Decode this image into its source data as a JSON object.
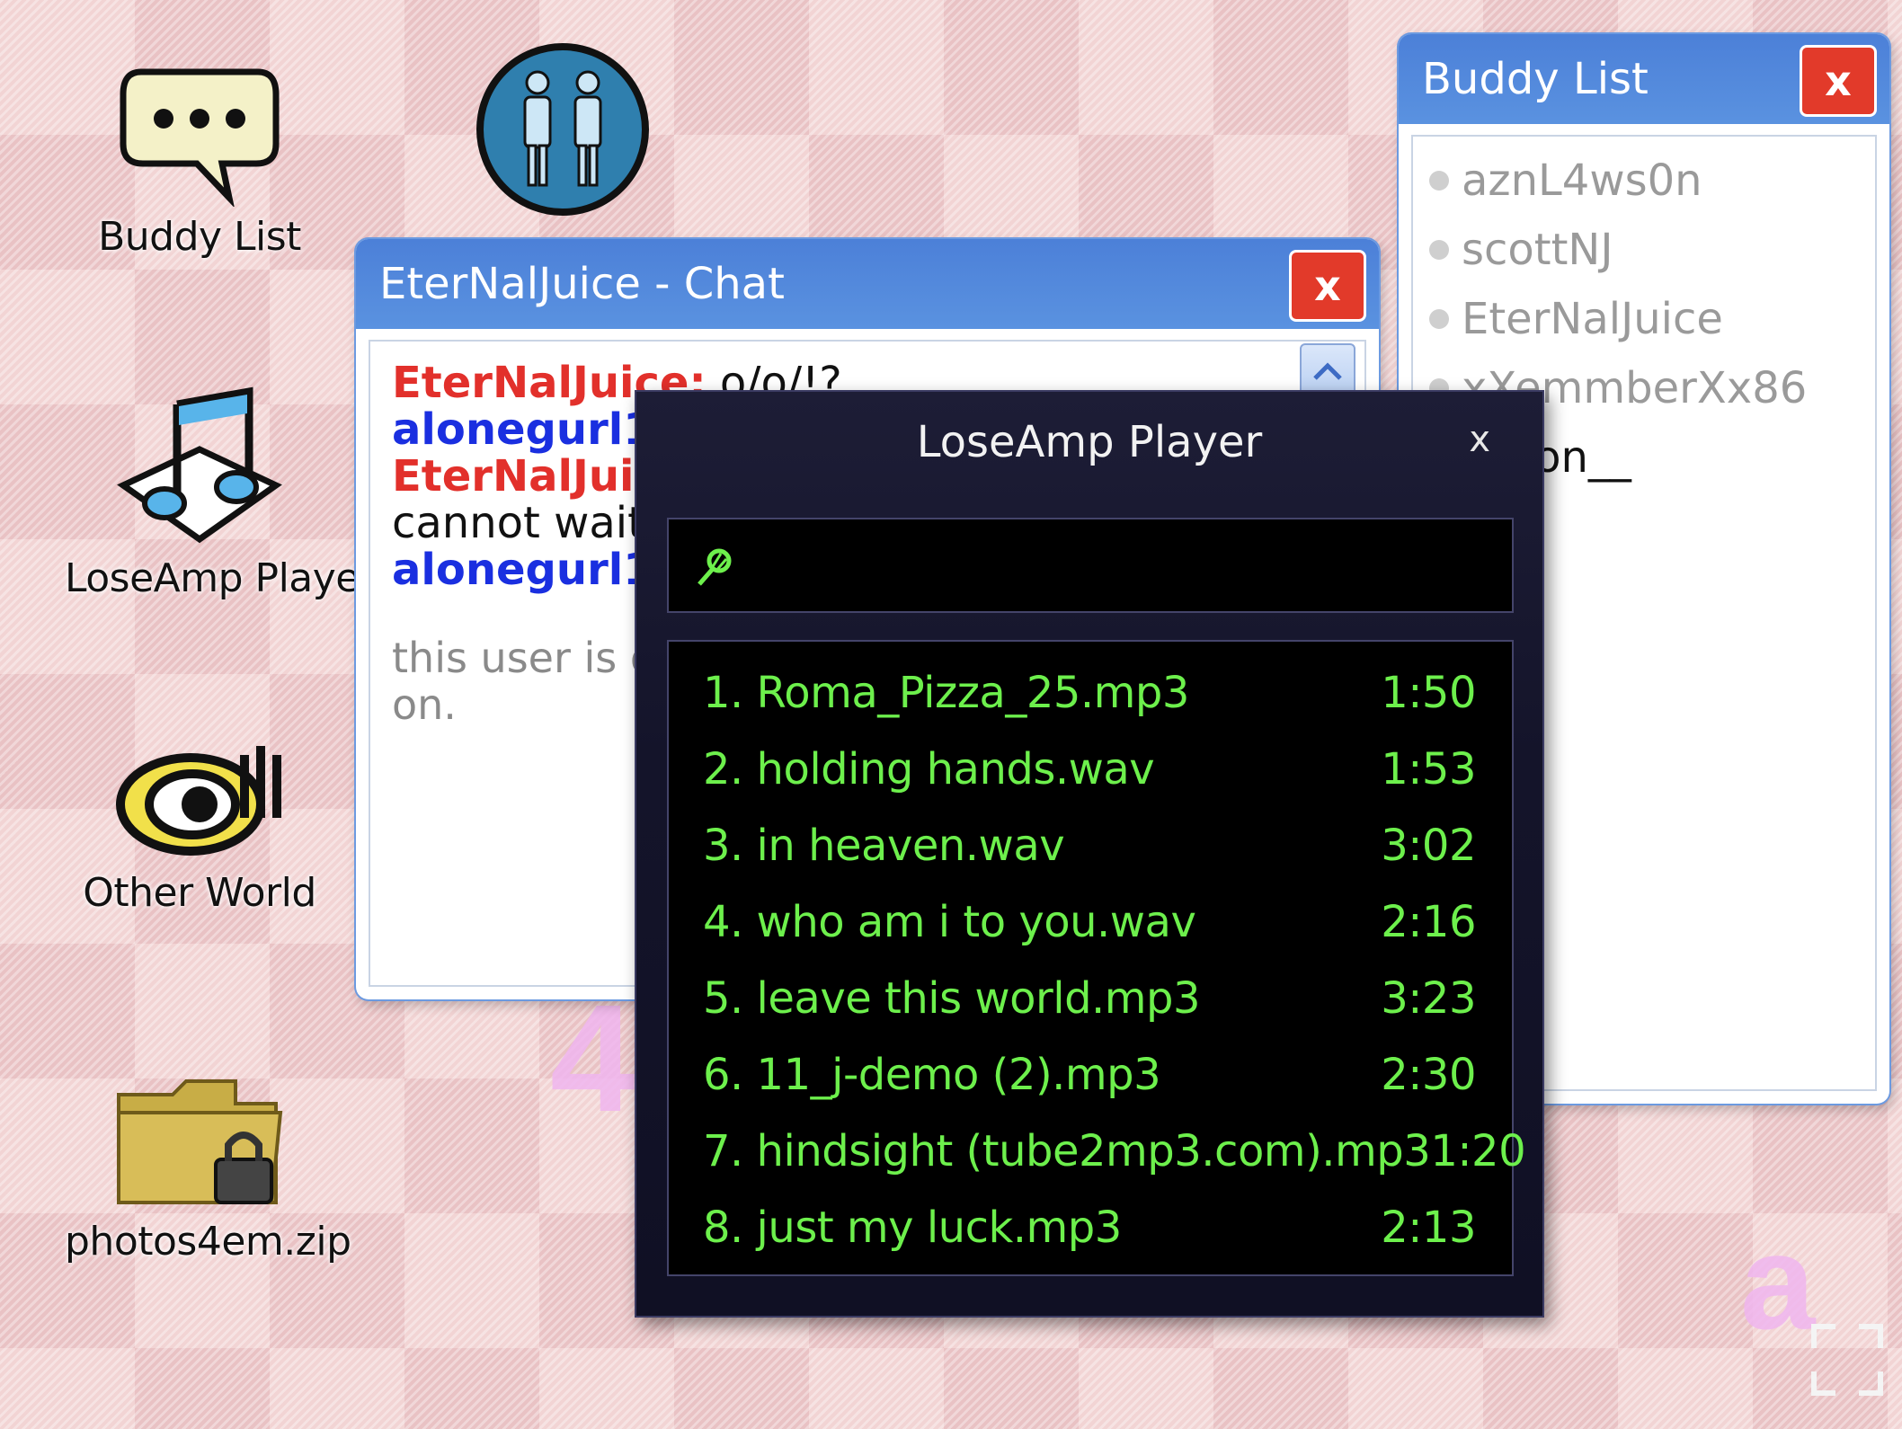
{
  "desktop": {
    "icons": [
      {
        "label": "Buddy List"
      },
      {
        "label": "LoseAmp Player"
      },
      {
        "label": "Other World"
      },
      {
        "label": "photos4em.zip"
      }
    ]
  },
  "chat_window": {
    "title": "EterNalJuice - Chat",
    "close_label": "x",
    "lines": [
      {
        "user": "EterNalJuice:",
        "text": " o/o/!?",
        "color": "red"
      },
      {
        "user": "alonegurl1",
        "text": "",
        "color": "blue"
      },
      {
        "user": "EterNalJui",
        "text": "",
        "color": "red"
      },
      {
        "user": "",
        "text": "cannot wait",
        "color": "none"
      },
      {
        "user": "alonegurl1",
        "text": "",
        "color": "blue"
      }
    ],
    "status_line1": "this user is o",
    "status_line2": "on."
  },
  "buddy_window": {
    "title": "Buddy List",
    "close_label": "x",
    "buddies": [
      "aznL4ws0n",
      "scottNJ",
      "EterNalJuice",
      "xXemmberXx86",
      "__rion__"
    ]
  },
  "player": {
    "title": "LoseAmp Player",
    "close_label": "x",
    "tracks": [
      {
        "name": "1. Roma_Pizza_25.mp3",
        "time": "1:50"
      },
      {
        "name": "2. holding hands.wav",
        "time": "1:53"
      },
      {
        "name": "3. in heaven.wav",
        "time": "3:02"
      },
      {
        "name": "4. who am i to you.wav",
        "time": "2:16"
      },
      {
        "name": "5. leave this world.mp3",
        "time": "3:23"
      },
      {
        "name": "6. 11_j-demo (2).mp3",
        "time": "2:30"
      },
      {
        "name": "7. hindsight (tube2mp3.com).mp3",
        "time": "1:20"
      },
      {
        "name": "8. just my luck.mp3",
        "time": "2:13"
      }
    ]
  },
  "colors": {
    "title_bar": "#4c80d8",
    "close_button": "#e23a2a",
    "track_text": "#6df04c",
    "user_red": "#e2302b",
    "user_blue": "#1a2fe0"
  }
}
